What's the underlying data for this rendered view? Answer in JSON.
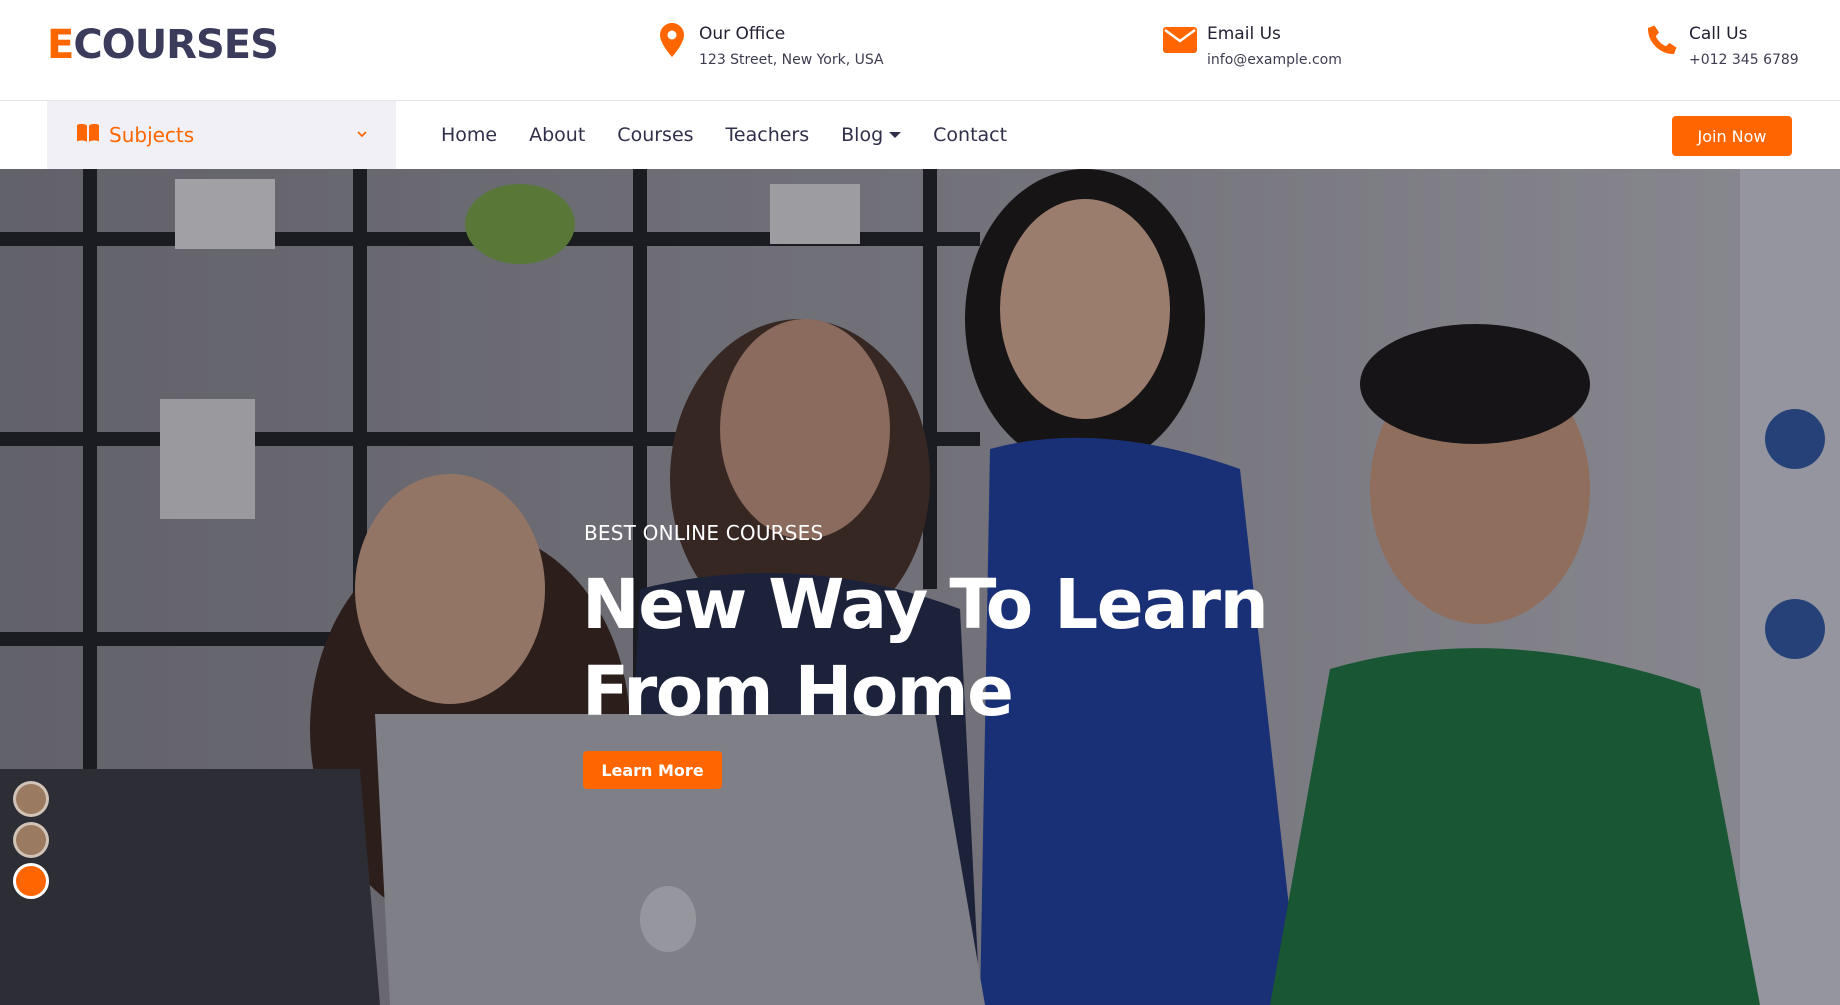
{
  "brand": {
    "first_letter": "E",
    "rest": "COURSES"
  },
  "contact": {
    "office": {
      "label": "Our Office",
      "value": "123 Street, New York, USA",
      "icon": "map-marker-icon"
    },
    "email": {
      "label": "Email Us",
      "value": "info@example.com",
      "icon": "envelope-icon"
    },
    "call": {
      "label": "Call Us",
      "value": "+012 345 6789",
      "icon": "phone-icon"
    }
  },
  "nav": {
    "subjects_label": "Subjects",
    "items": [
      "Home",
      "About",
      "Courses",
      "Teachers",
      "Blog",
      "Contact"
    ],
    "join_label": "Join Now"
  },
  "hero": {
    "kicker": "BEST ONLINE COURSES",
    "headline": "New Way To Learn From Home",
    "cta": "Learn More",
    "slides": 3,
    "active_slide": 3
  },
  "colors": {
    "accent": "#ff6600",
    "brand_dark": "#3b3b5c",
    "subjects_bg": "#f1f0f6"
  }
}
